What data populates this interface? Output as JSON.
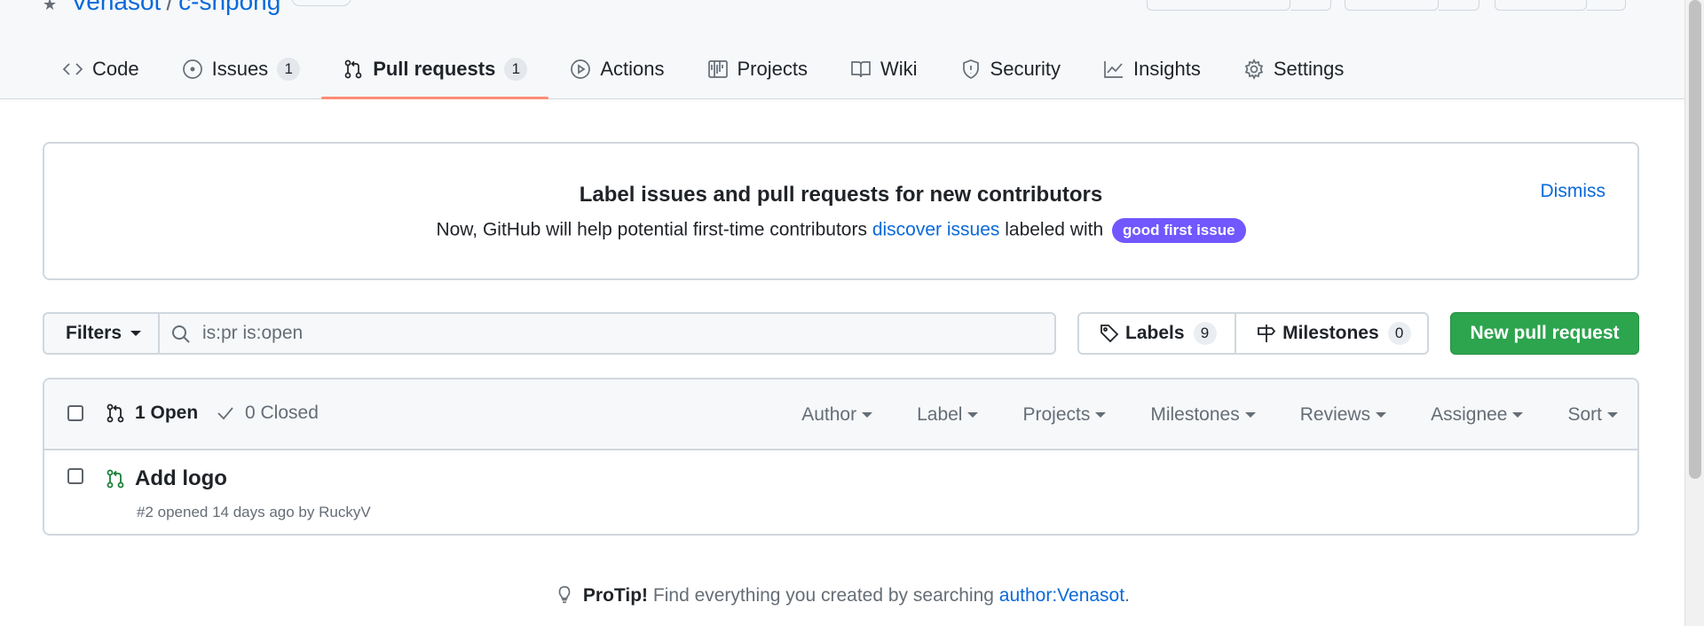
{
  "repo": {
    "owner": "Venasot",
    "separator": "/",
    "name": "c-shpong"
  },
  "nav": {
    "tabs": [
      {
        "label": "Code"
      },
      {
        "label": "Issues",
        "count": "1"
      },
      {
        "label": "Pull requests",
        "count": "1",
        "selected": true
      },
      {
        "label": "Actions"
      },
      {
        "label": "Projects"
      },
      {
        "label": "Wiki"
      },
      {
        "label": "Security"
      },
      {
        "label": "Insights"
      },
      {
        "label": "Settings"
      }
    ]
  },
  "banner": {
    "title": "Label issues and pull requests for new contributors",
    "text_before": "Now, GitHub will help potential first-time contributors",
    "link": "discover issues",
    "text_after": "labeled with",
    "label": "good first issue",
    "dismiss": "Dismiss"
  },
  "filter_bar": {
    "filters_label": "Filters",
    "search_value": "is:pr is:open",
    "labels_label": "Labels",
    "labels_count": "9",
    "milestones_label": "Milestones",
    "milestones_count": "0",
    "new_pr_label": "New pull request"
  },
  "list": {
    "open_label": "1 Open",
    "closed_label": "0 Closed",
    "header_filters": [
      "Author",
      "Label",
      "Projects",
      "Milestones",
      "Reviews",
      "Assignee",
      "Sort"
    ],
    "items": [
      {
        "title": "Add logo",
        "meta": "#2 opened 14 days ago by RuckyV"
      }
    ]
  },
  "protip": {
    "bold": "ProTip!",
    "text": "Find everything you created by searching",
    "link": "author:Venasot",
    "end": "."
  },
  "colors": {
    "accent": "#0969da",
    "selected_underline": "#fd8c73",
    "new_pr_green": "#2da44e",
    "gfi_label": "#7057ff",
    "open_pr_icon": "#1a7f37"
  }
}
